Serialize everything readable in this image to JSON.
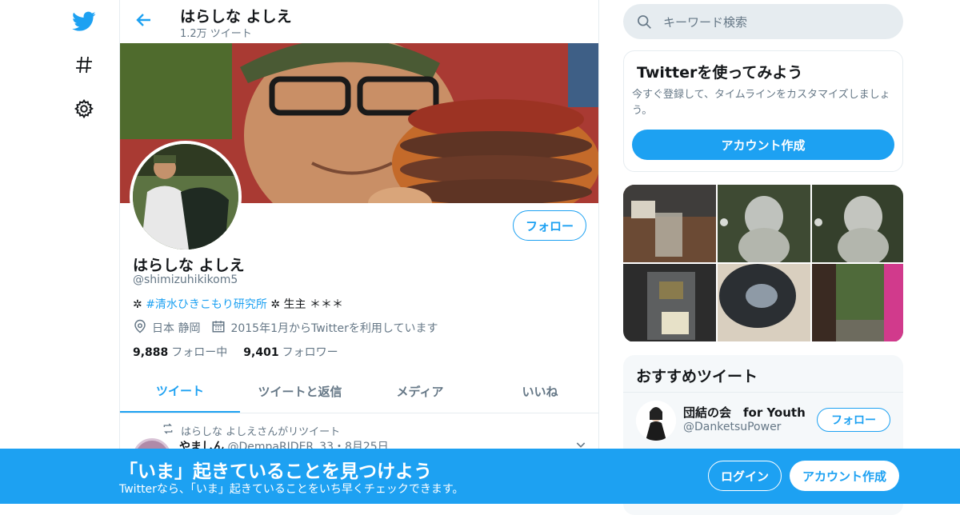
{
  "nav": {
    "twitter_icon": "bird-icon",
    "explore_icon": "hash-icon",
    "settings_icon": "gear-icon"
  },
  "header": {
    "name": "はらしな よしえ",
    "tweet_count": "1.2万 ツイート"
  },
  "profile": {
    "follow_label": "フォロー",
    "name": "はらしな よしえ",
    "handle": "@shimizuhikikom5",
    "bio_prefix": "✲ ",
    "bio_tag": "#清水ひきこもり研究所",
    "bio_suffix": " ✲ 生主 ＊＊＊",
    "location": "日本 静岡",
    "joined": "2015年1月からTwitterを利用しています",
    "following_count": "9,888",
    "following_label": "フォロー中",
    "followers_count": "9,401",
    "followers_label": "フォロワー"
  },
  "tabs": [
    {
      "label": "ツイート"
    },
    {
      "label": "ツイートと返信"
    },
    {
      "label": "メディア"
    },
    {
      "label": "いいね"
    }
  ],
  "timeline": {
    "retweet_text": "はらしな よしえさんがリツイート",
    "tweet_name": "やましん",
    "tweet_meta": "@DempaRIDER_33・8月25日"
  },
  "right": {
    "search_placeholder": "キーワード検索",
    "signup_box": {
      "title": "Twitterを使ってみよう",
      "text": "今すぐ登録して、タイムラインをカスタマイズしましょう。",
      "button": "アカウント作成"
    },
    "recommended": {
      "title": "おすすめツイート",
      "name": "団結の会　for Youth",
      "handle": "@DanketsuPower",
      "follow": "フォロー"
    }
  },
  "bottom_bar": {
    "headline": "「いま」起きていることを見つけよう",
    "sub": "Twitterなら、「いま」起きていることをいち早くチェックできます。",
    "login": "ログイン",
    "signup": "アカウント作成"
  },
  "colors": {
    "accent": "#1da1f2",
    "muted": "#657786",
    "border": "#e6ecf0"
  }
}
